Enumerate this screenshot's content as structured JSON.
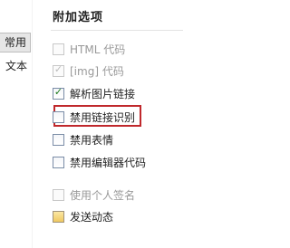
{
  "left": {
    "tab_label": "常用",
    "text_label": "文本"
  },
  "panel": {
    "title": "附加选项",
    "options": [
      {
        "label": "HTML 代码",
        "checked": false,
        "disabled": true
      },
      {
        "label": "[img] 代码",
        "checked": true,
        "disabled": true
      },
      {
        "label": "解析图片链接",
        "checked": true,
        "disabled": false
      },
      {
        "label": "禁用链接识别",
        "checked": false,
        "disabled": false,
        "highlighted": true
      },
      {
        "label": "禁用表情",
        "checked": false,
        "disabled": false
      },
      {
        "label": "禁用编辑器代码",
        "checked": false,
        "disabled": false
      },
      {
        "label": "使用个人签名",
        "checked": false,
        "disabled": true
      },
      {
        "label": "发送动态",
        "checked": false,
        "disabled": false
      }
    ]
  },
  "colors": {
    "highlight_border": "#c0282c",
    "check_mark": "#1c7a1c",
    "disabled_text": "#999999"
  },
  "icons": {
    "check": "check-icon"
  }
}
